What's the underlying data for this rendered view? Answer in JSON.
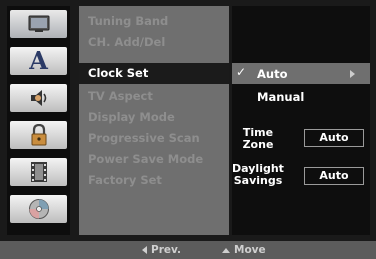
{
  "icons": [
    {
      "name": "tv-icon",
      "active": true
    },
    {
      "name": "language-icon",
      "glyph": "A"
    },
    {
      "name": "speaker-icon"
    },
    {
      "name": "lock-icon"
    },
    {
      "name": "film-icon"
    },
    {
      "name": "disc-icon"
    }
  ],
  "menu": {
    "items": [
      {
        "label": "Tuning Band",
        "selected": false
      },
      {
        "label": "CH. Add/Del",
        "selected": false
      },
      {
        "label": "Clock Set",
        "selected": true
      },
      {
        "label": "TV Aspect",
        "selected": false
      },
      {
        "label": "Display Mode",
        "selected": false
      },
      {
        "label": "Progressive Scan",
        "selected": false
      },
      {
        "label": "Power Save Mode",
        "selected": false
      },
      {
        "label": "Factory Set",
        "selected": false
      }
    ]
  },
  "options": {
    "clock_mode": {
      "selected_label": "Auto",
      "other_label": "Manual"
    },
    "time_zone": {
      "label_line1": "Time",
      "label_line2": "Zone",
      "value": "Auto"
    },
    "daylight_savings": {
      "label_line1": "Daylight",
      "label_line2": "Savings",
      "value": "Auto"
    }
  },
  "footer": {
    "prev_label": "Prev.",
    "move_label": "Move"
  },
  "colors": {
    "menu_panel": "#6f6f6f",
    "selected_row": "#1b1b1b",
    "background": "#0e0e0e"
  }
}
